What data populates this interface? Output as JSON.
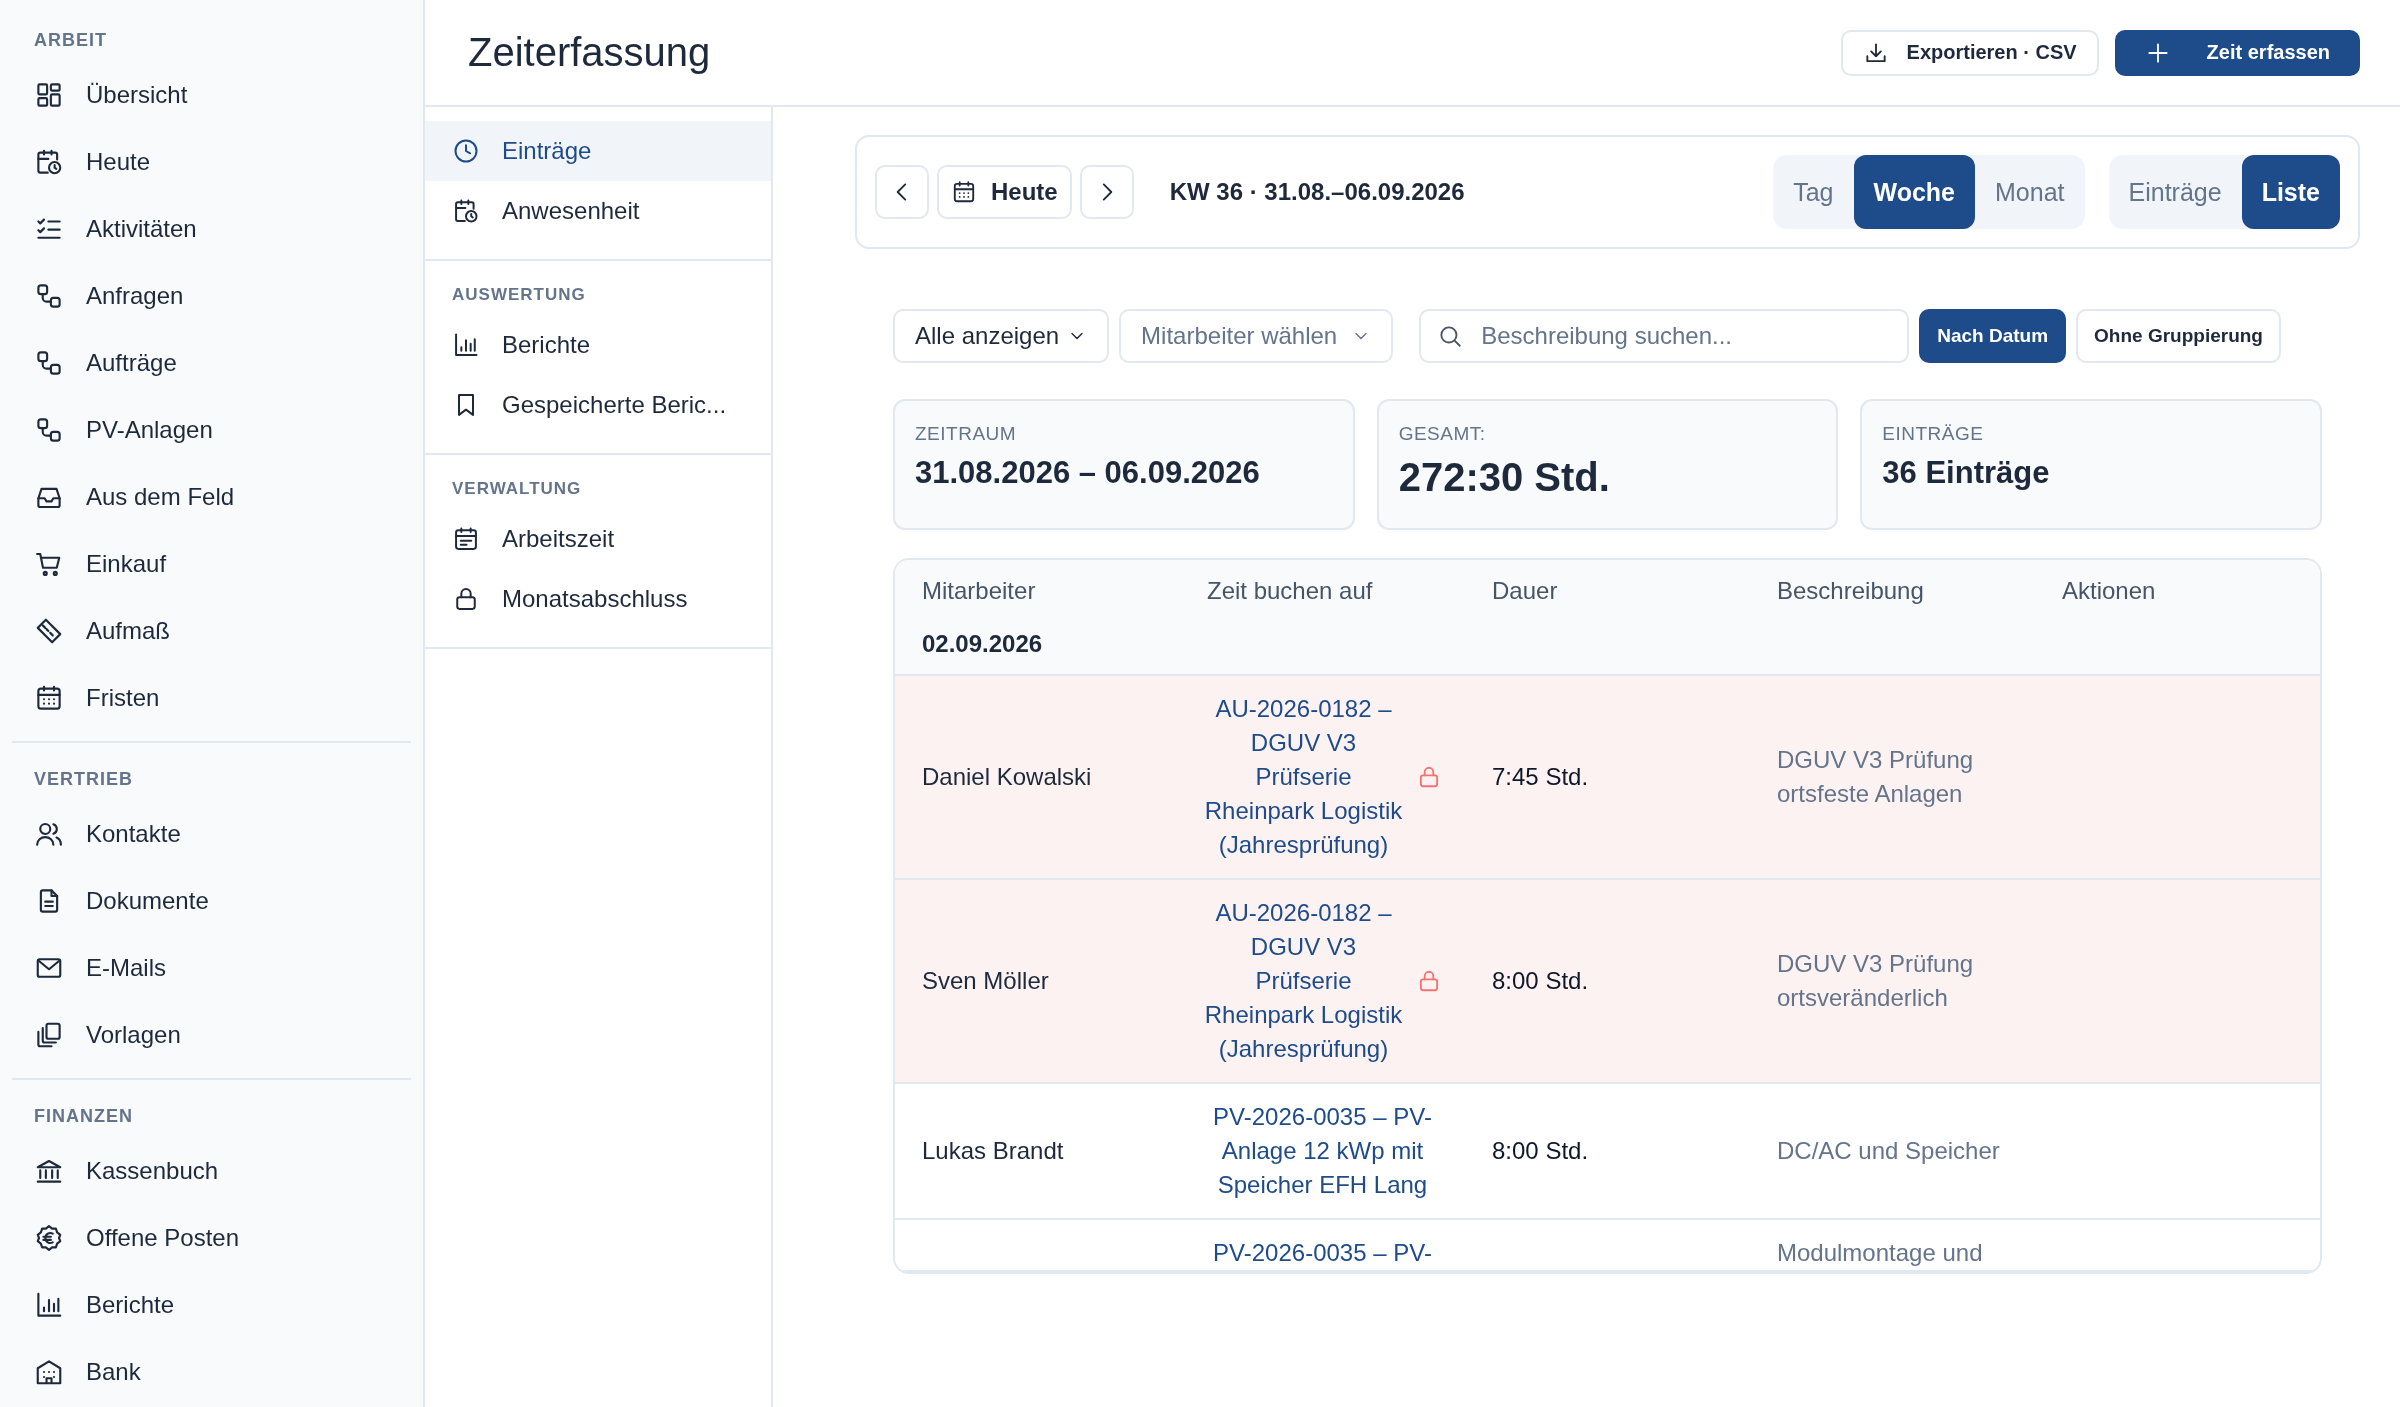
{
  "sidebar": {
    "sections": [
      {
        "label": "ARBEIT",
        "items": [
          {
            "label": "Übersicht",
            "selected": false
          },
          {
            "label": "Heute",
            "selected": false
          },
          {
            "label": "Aktivitäten",
            "selected": false
          },
          {
            "label": "Anfragen",
            "selected": false
          },
          {
            "label": "Aufträge",
            "selected": false
          },
          {
            "label": "PV-Anlagen",
            "selected": false
          },
          {
            "label": "Aus dem Feld",
            "selected": false
          },
          {
            "label": "Einkauf",
            "selected": false
          },
          {
            "label": "Aufmaß",
            "selected": false
          },
          {
            "label": "Fristen",
            "selected": false
          }
        ]
      },
      {
        "label": "VERTRIEB",
        "items": [
          {
            "label": "Kontakte",
            "selected": false
          },
          {
            "label": "Dokumente",
            "selected": false
          },
          {
            "label": "E-Mails",
            "selected": false
          },
          {
            "label": "Vorlagen",
            "selected": false
          }
        ]
      },
      {
        "label": "FINANZEN",
        "items": [
          {
            "label": "Kassenbuch",
            "selected": false
          },
          {
            "label": "Offene Posten",
            "selected": false
          },
          {
            "label": "Berichte",
            "selected": false
          },
          {
            "label": "Bank",
            "selected": false
          }
        ]
      }
    ]
  },
  "page": {
    "title": "Zeiterfassung",
    "actions": [
      {
        "label": "Exportieren · CSV",
        "kind": "export"
      },
      {
        "label": "Zeit erfassen",
        "kind": "primary"
      }
    ]
  },
  "subnav": {
    "sections": [
      {
        "items": [
          {
            "label": "Einträge",
            "selected": true
          },
          {
            "label": "Anwesenheit",
            "selected": false
          }
        ]
      },
      {
        "label": "AUSWERTUNG",
        "items": [
          {
            "label": "Berichte",
            "selected": false
          },
          {
            "label": "Gespeicherte Beric...",
            "selected": false
          }
        ]
      },
      {
        "label": "VERWALTUNG",
        "items": [
          {
            "label": "Arbeitszeit",
            "selected": false
          },
          {
            "label": "Monatsabschluss",
            "selected": false
          }
        ]
      }
    ]
  },
  "toolbar": {
    "today": "Heute",
    "period": "KW 36 · 31.08.–06.09.2026",
    "ranges": [
      {
        "label": "Tag",
        "selected": false
      },
      {
        "label": "Woche",
        "selected": true
      },
      {
        "label": "Monat",
        "selected": false
      }
    ],
    "views": [
      {
        "label": "Einträge",
        "selected": false
      },
      {
        "label": "Liste",
        "selected": true
      }
    ]
  },
  "filters": {
    "status": {
      "value": "Alle anzeigen"
    },
    "employee": {
      "placeholder": "Mitarbeiter wählen"
    },
    "search": {
      "placeholder": "Beschreibung suchen..."
    },
    "grouping": [
      {
        "label": "Nach Datum",
        "selected": true
      },
      {
        "label": "Ohne Gruppierung",
        "selected": false
      }
    ]
  },
  "stats": [
    {
      "label": "ZEITRAUM",
      "value": "31.08.2026 – 06.09.2026",
      "kind": "normal"
    },
    {
      "label": "GESAMT:",
      "value": "272:30 Std.",
      "kind": "total"
    },
    {
      "label": "EINTRÄGE",
      "value": "36 Einträge",
      "kind": "normal"
    }
  ],
  "table": {
    "columns": [
      "Mitarbeiter",
      "Zeit buchen auf",
      "Dauer",
      "Beschreibung",
      "Aktionen"
    ],
    "group": "02.09.2026",
    "rows": [
      {
        "employee": "Daniel Kowalski",
        "booking": "AU-2026-0182 – DGUV V3 Prüfserie Rheinpark Logistik (Jahresprüfung)",
        "locked": true,
        "duration": "7:45 Std.",
        "description": "DGUV V3 Prüfung ortsfeste Anlagen"
      },
      {
        "employee": "Sven Möller",
        "booking": "AU-2026-0182 – DGUV V3 Prüfserie Rheinpark Logistik (Jahresprüfung)",
        "locked": true,
        "duration": "8:00 Std.",
        "description": "DGUV V3 Prüfung ortsveränderlich"
      },
      {
        "employee": "Lukas Brandt",
        "booking": "PV-2026-0035 – PV-Anlage 12 kWp mit Speicher EFH Lang",
        "locked": false,
        "duration": "8:00 Std.",
        "description": "DC/AC und Speicher"
      },
      {
        "booking": "PV-2026-0035 – PV-",
        "locked": false,
        "description": "Modulmontage und"
      }
    ]
  }
}
